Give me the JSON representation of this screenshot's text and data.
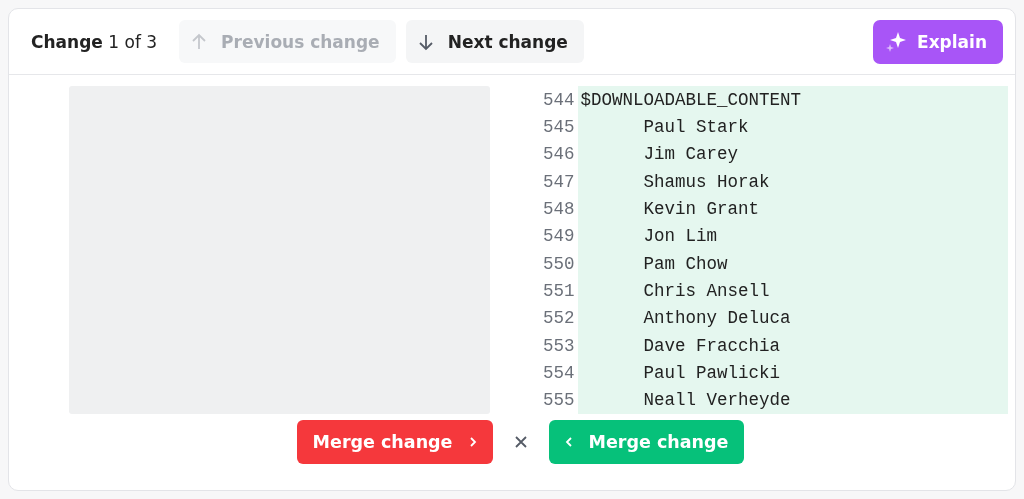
{
  "header": {
    "label": "Change",
    "position": "1 of 3"
  },
  "nav_buttons": [
    {
      "kind": "up",
      "label": "Previous change",
      "disabled": true
    },
    {
      "kind": "down",
      "label": "Next change",
      "disabled": false
    }
  ],
  "explain_button": {
    "label": "Explain"
  },
  "right_pane": {
    "lines": [
      {
        "number": "544",
        "text": "$DOWNLOADABLE_CONTENT"
      },
      {
        "number": "545",
        "text": "      Paul Stark"
      },
      {
        "number": "546",
        "text": "      Jim Carey"
      },
      {
        "number": "547",
        "text": "      Shamus Horak"
      },
      {
        "number": "548",
        "text": "      Kevin Grant"
      },
      {
        "number": "549",
        "text": "      Jon Lim"
      },
      {
        "number": "550",
        "text": "      Pam Chow"
      },
      {
        "number": "551",
        "text": "      Chris Ansell"
      },
      {
        "number": "552",
        "text": "      Anthony Deluca"
      },
      {
        "number": "553",
        "text": "      Dave Fracchia"
      },
      {
        "number": "554",
        "text": "      Paul Pawlicki"
      },
      {
        "number": "555",
        "text": "      Neall Verheyde"
      }
    ]
  },
  "merge_buttons": [
    {
      "kind": "right",
      "label": "Merge change"
    },
    {
      "kind": "left",
      "label": "Merge change"
    }
  ]
}
